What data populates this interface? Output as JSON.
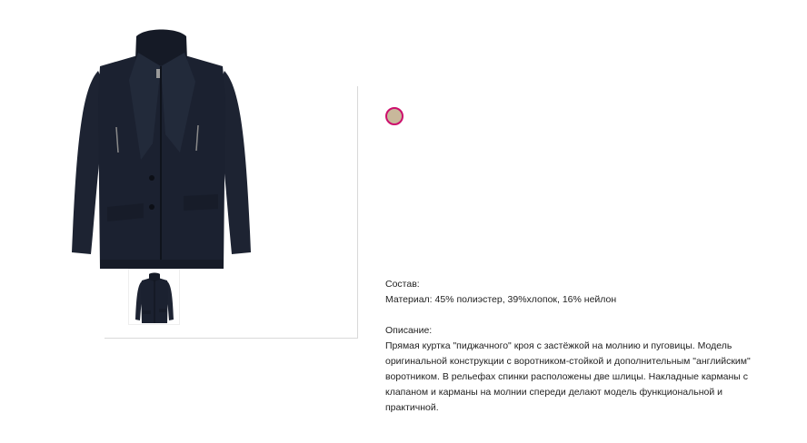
{
  "product": {
    "main_image_alt": "jacket",
    "thumbnail_alt": "jacket-thumbnail",
    "color_swatch": "#c8b89b",
    "swatch_border": "#cc0f6d"
  },
  "details": {
    "composition_label": "Состав:",
    "material": "Материал: 45% полиэстер, 39%хлопок, 16% нейлон",
    "description_label": "Описание:",
    "description": "Прямая куртка \"пиджачного\" кроя с застёжкой на молнию и пуговицы. Модель оригинальной конструкции с воротником-стойкой и  дополнительным \"английским\" воротником. В рельефах спинки расположены две шлицы. Накладные карманы с клапаном и карманы на молнии спереди делают модель функциональной и практичной."
  }
}
